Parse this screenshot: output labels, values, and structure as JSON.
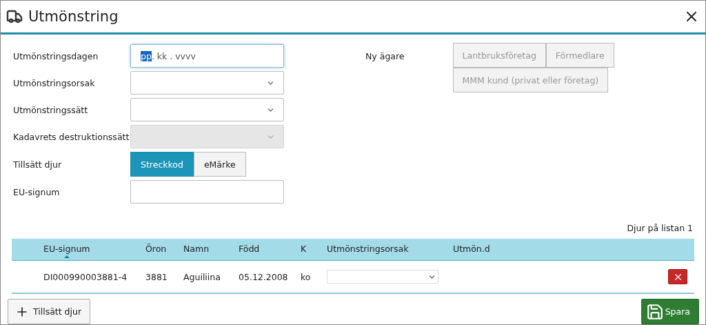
{
  "window": {
    "title": "Utmönstring"
  },
  "form": {
    "fields": [
      {
        "label": "Utmönstringsdagen",
        "kind": "date",
        "segments": [
          {
            "text": "pp",
            "selected": true
          },
          {
            "text": ". kk . vvvv",
            "selected": false
          }
        ]
      },
      {
        "label": "Utmönstringsorsak",
        "kind": "select",
        "disabled": false
      },
      {
        "label": "Utmönstringssätt",
        "kind": "select",
        "disabled": false
      },
      {
        "label": "Kadavrets destruktionssätt",
        "kind": "select",
        "disabled": true
      },
      {
        "label": "Tillsätt djur",
        "kind": "toggle",
        "options": [
          {
            "label": "Streckkod",
            "selected": true
          },
          {
            "label": "eMärke",
            "selected": false
          }
        ]
      },
      {
        "label": "EU-signum",
        "kind": "text"
      }
    ],
    "owner": {
      "label": "Ny ägare",
      "options": [
        {
          "label": "Lantbruksföretag",
          "disabled": true
        },
        {
          "label": "Förmedlare",
          "disabled": true
        },
        {
          "label": "MMM kund (privat eller företag)",
          "disabled": true
        }
      ]
    }
  },
  "count_label": "Djur på listan 1",
  "table": {
    "columns": [
      {
        "label": "EU-signum",
        "sorted": true
      },
      {
        "label": "Öron",
        "sorted": false
      },
      {
        "label": "Namn",
        "sorted": false
      },
      {
        "label": "Född",
        "sorted": false
      },
      {
        "label": "K",
        "sorted": false
      },
      {
        "label": "Utmönstringsorsak",
        "sorted": false
      },
      {
        "label": "Utmön.d",
        "sorted": false
      }
    ],
    "rows": [
      {
        "cells": [
          "DI000990003881-4",
          "3881",
          "Aguiliina",
          "05.12.2008",
          "ko"
        ]
      }
    ]
  },
  "footer": {
    "add_button": "Tillsätt djur",
    "save_button": "Spara"
  }
}
